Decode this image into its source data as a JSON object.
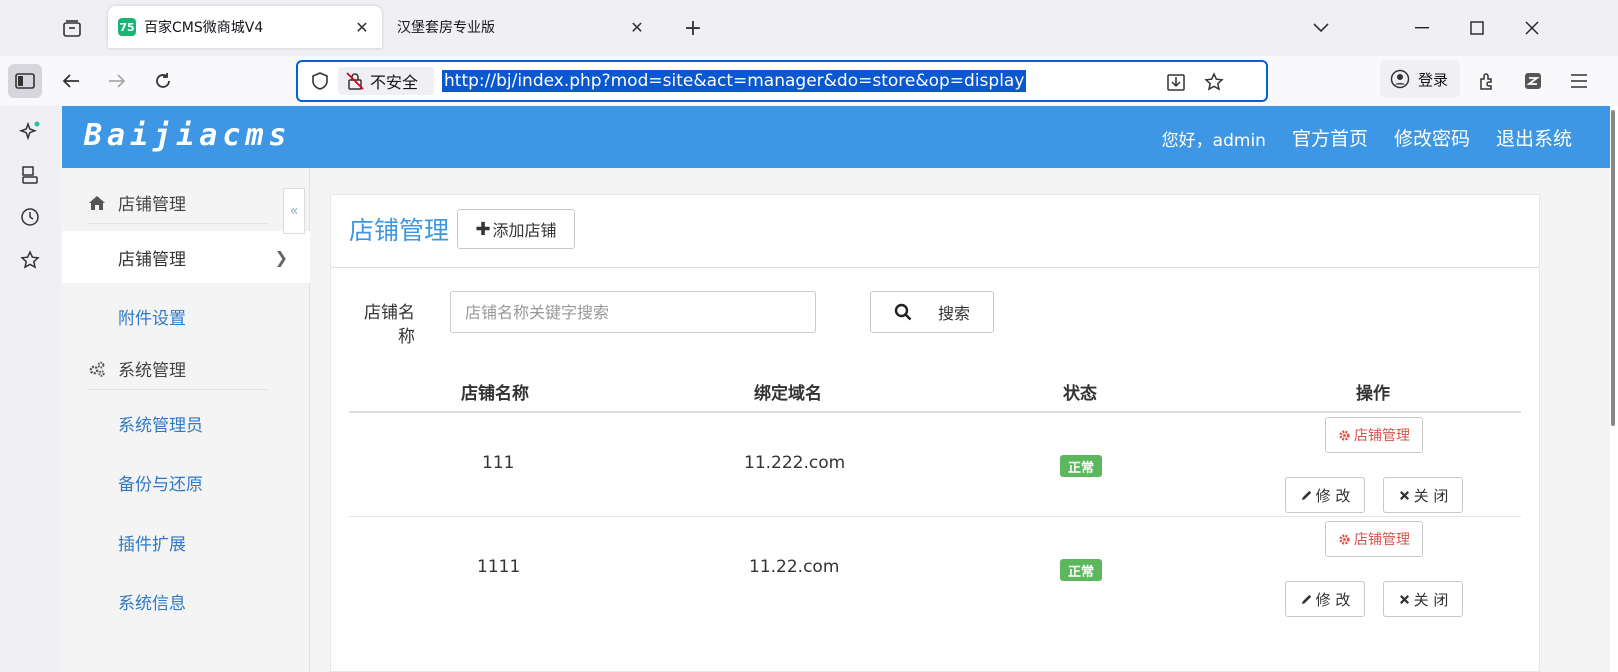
{
  "browser": {
    "tabs": [
      {
        "title": "百家CMS微商城V4",
        "favicon_text": "75",
        "active": true
      },
      {
        "title": "汉堡套房专业版",
        "active": false
      }
    ],
    "url": "http://bj/index.php?mod=site&act=manager&do=store&op=display",
    "security_label": "不安全",
    "login_label": "登录"
  },
  "app": {
    "logo": "Baijiacms",
    "header_links": {
      "greeting": "您好，admin",
      "home": "官方首页",
      "change_password": "修改密码",
      "logout": "退出系统"
    }
  },
  "menu": {
    "groups": [
      {
        "label": "店铺管理",
        "icon": "home-icon"
      },
      {
        "label": "系统管理",
        "icon": "gears-icon"
      }
    ],
    "items": [
      {
        "label": "店铺管理",
        "active": true
      },
      {
        "label": "附件设置"
      },
      {
        "label": "系统管理员"
      },
      {
        "label": "备份与还原"
      },
      {
        "label": "插件扩展"
      },
      {
        "label": "系统信息"
      }
    ]
  },
  "content": {
    "title": "店铺管理",
    "add_button": "添加店铺",
    "filter": {
      "label": "店铺名称",
      "placeholder": "店铺名称关键字搜索",
      "search_button": "搜索"
    },
    "table": {
      "headers": [
        "店铺名称",
        "绑定域名",
        "状态",
        "操作"
      ],
      "rows": [
        {
          "name": "111",
          "domain": "11.222.com",
          "status": "正常"
        },
        {
          "name": "1111",
          "domain": "11.22.com",
          "status": "正常"
        }
      ],
      "actions": {
        "manage": "店铺管理",
        "edit": "修 改",
        "close": "关 闭"
      }
    }
  },
  "colors": {
    "header_bg": "#3e97e4",
    "accent": "#3e97e4",
    "badge": "#5cb85c",
    "danger": "#d9534f",
    "link": "#2e7ac8"
  }
}
